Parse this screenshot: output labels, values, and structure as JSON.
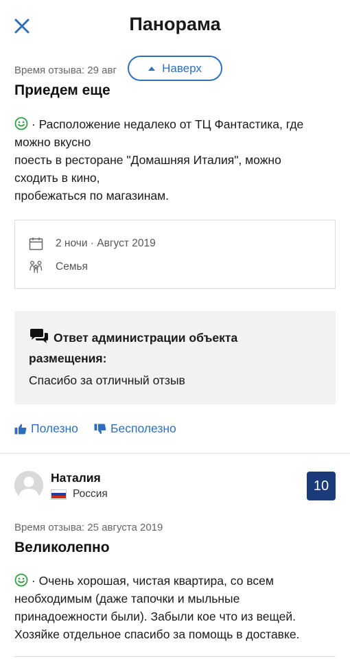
{
  "header": {
    "title": "Панорама",
    "back_to_top": "Наверх"
  },
  "review1": {
    "date": "Время отзыва: 29 авг",
    "title": "Приедем еще",
    "text_lines": [
      "· Расположение недалеко от ТЦ Фантастика, где",
      "можно вкусно",
      "поесть в ресторане \"Домашняя Италия\", можно",
      "сходить в кино,",
      "пробежаться по магазинам."
    ],
    "stay": {
      "duration": "2 ночи · Август 2019",
      "traveler_type": "Семья"
    },
    "admin_reply": {
      "title": "Ответ администрации объекта размещения:",
      "text": "Спасибо за отличный отзыв"
    },
    "helpful_label": "Полезно",
    "unhelpful_label": "Бесполезно"
  },
  "review2": {
    "author": "Наталия",
    "country": "Россия",
    "score": "10",
    "date": "Время отзыва: 25 августа 2019",
    "title": "Великолепно",
    "text_lines": [
      "· Очень хорошая, чистая квартира, со всем",
      "необходимым (даже тапочки и мыльные",
      "принадоежности были). Забыли кое что из вещей.",
      "Хозяйке отдельное спасибо за помощь в доставке."
    ]
  },
  "icons": {
    "close": "close-icon",
    "calendar": "calendar-icon",
    "family": "family-icon",
    "chat": "chat-bubbles-icon",
    "smiley": "smiley-icon",
    "thumb_up": "thumb-up-icon",
    "thumb_down": "thumb-down-icon"
  },
  "colors": {
    "accent": "#2d6fbd",
    "score_bg": "#1b3a7a",
    "positive": "#2e9e3e"
  }
}
